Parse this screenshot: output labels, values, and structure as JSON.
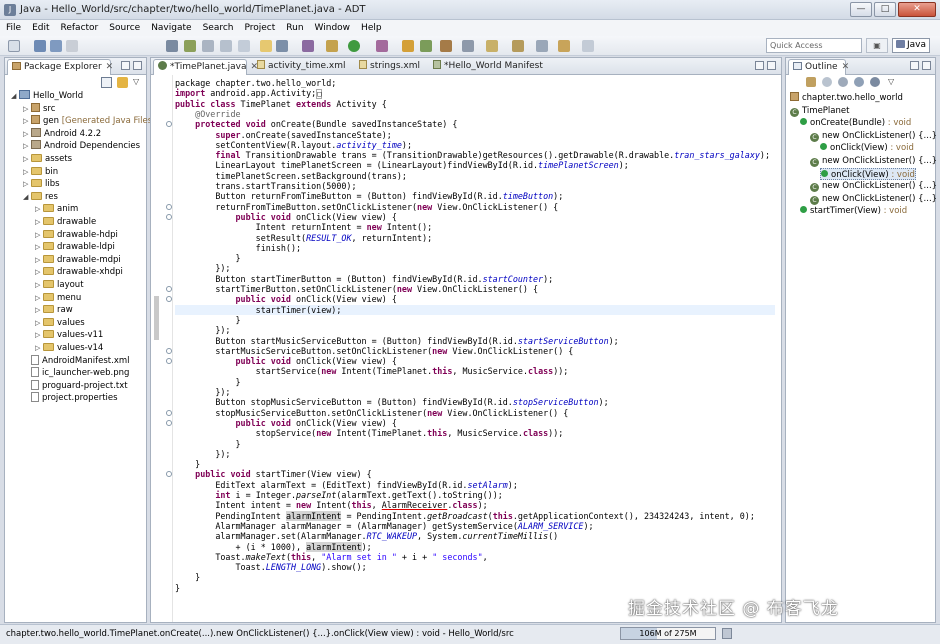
{
  "window": {
    "title": "Java - Hello_World/src/chapter/two/hello_world/TimePlanet.java - ADT",
    "minimize": "—",
    "maximize": "□",
    "close": "✕"
  },
  "menu": [
    "File",
    "Edit",
    "Refactor",
    "Source",
    "Navigate",
    "Search",
    "Project",
    "Run",
    "Window",
    "Help"
  ],
  "toolbar": {
    "quick_access_placeholder": "Quick Access",
    "perspective": "Java"
  },
  "package_explorer": {
    "tab_label": "Package Explorer",
    "tree": [
      {
        "label": "Hello_World",
        "level": 0,
        "icon": "project-icon",
        "expanded": true
      },
      {
        "label": "src",
        "level": 1,
        "icon": "source-folder-icon"
      },
      {
        "label": "gen",
        "decoration": "[Generated Java Files]",
        "level": 1,
        "icon": "source-folder-icon"
      },
      {
        "label": "Android 4.2.2",
        "level": 1,
        "icon": "library-icon"
      },
      {
        "label": "Android Dependencies",
        "level": 1,
        "icon": "library-icon"
      },
      {
        "label": "assets",
        "level": 1,
        "icon": "folder-icon"
      },
      {
        "label": "bin",
        "level": 1,
        "icon": "folder-icon"
      },
      {
        "label": "libs",
        "level": 1,
        "icon": "folder-icon"
      },
      {
        "label": "res",
        "level": 1,
        "icon": "folder-icon",
        "expanded": true
      },
      {
        "label": "anim",
        "level": 2,
        "icon": "folder-icon"
      },
      {
        "label": "drawable",
        "level": 2,
        "icon": "folder-icon"
      },
      {
        "label": "drawable-hdpi",
        "level": 2,
        "icon": "folder-icon"
      },
      {
        "label": "drawable-ldpi",
        "level": 2,
        "icon": "folder-icon"
      },
      {
        "label": "drawable-mdpi",
        "level": 2,
        "icon": "folder-icon"
      },
      {
        "label": "drawable-xhdpi",
        "level": 2,
        "icon": "folder-icon"
      },
      {
        "label": "layout",
        "level": 2,
        "icon": "folder-icon"
      },
      {
        "label": "menu",
        "level": 2,
        "icon": "folder-icon"
      },
      {
        "label": "raw",
        "level": 2,
        "icon": "folder-icon"
      },
      {
        "label": "values",
        "level": 2,
        "icon": "folder-icon"
      },
      {
        "label": "values-v11",
        "level": 2,
        "icon": "folder-icon"
      },
      {
        "label": "values-v14",
        "level": 2,
        "icon": "folder-icon"
      },
      {
        "label": "AndroidManifest.xml",
        "level": 1,
        "icon": "file-icon"
      },
      {
        "label": "ic_launcher-web.png",
        "level": 1,
        "icon": "file-icon"
      },
      {
        "label": "proguard-project.txt",
        "level": 1,
        "icon": "file-icon"
      },
      {
        "label": "project.properties",
        "level": 1,
        "icon": "file-icon"
      }
    ]
  },
  "editor": {
    "tabs": [
      {
        "label": "*TimePlanet.java",
        "active": true
      },
      {
        "label": "activity_time.xml"
      },
      {
        "label": "strings.xml"
      },
      {
        "label": "*Hello_World Manifest"
      }
    ]
  },
  "outline": {
    "tab_label": "Outline",
    "items": [
      {
        "label": "chapter.two.hello_world",
        "indent": 0,
        "icon": "package-icon"
      },
      {
        "label": "TimePlanet",
        "indent": 0,
        "icon": "class-icon"
      },
      {
        "label": "onCreate(Bundle)",
        "type": ": void",
        "indent": 1,
        "icon": "method-public-icon"
      },
      {
        "label": "new OnClickListener() {...}",
        "indent": 2,
        "icon": "anon-class-icon"
      },
      {
        "label": "onClick(View)",
        "type": ": void",
        "indent": 3,
        "icon": "method-public-icon"
      },
      {
        "label": "new OnClickListener() {...}",
        "indent": 2,
        "icon": "anon-class-icon"
      },
      {
        "label": "onClick(View)",
        "type": ": void",
        "indent": 3,
        "icon": "method-public-icon",
        "selected": true
      },
      {
        "label": "new OnClickListener() {...}",
        "indent": 2,
        "icon": "anon-class-icon"
      },
      {
        "label": "new OnClickListener() {...}",
        "indent": 2,
        "icon": "anon-class-icon"
      },
      {
        "label": "startTimer(View)",
        "type": ": void",
        "indent": 1,
        "icon": "method-public-icon"
      }
    ]
  },
  "status": {
    "path": "chapter.two.hello_world.TimePlanet.onCreate(...).new OnClickListener() {...}.onClick(View view) : void - Hello_World/src",
    "heap": "106M of 275M",
    "heap_fraction": 0.385
  },
  "watermark": "掘金技术社区 @ 布客飞龙"
}
